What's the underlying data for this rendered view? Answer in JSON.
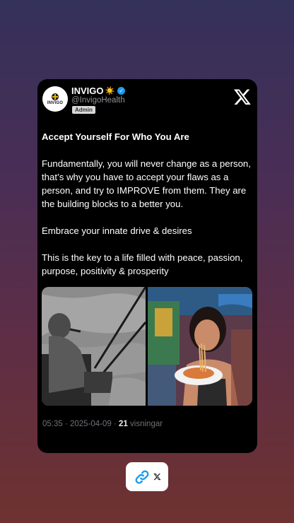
{
  "post": {
    "display_name": "INVIGO",
    "name_emoji": "☀️",
    "handle": "@InvigoHealth",
    "badge": "Admin",
    "avatar_text": "INVIGO",
    "title": "Accept Yourself For Who You Are",
    "paragraphs": [
      "Fundamentally, you will never change as a person, that’s why you have to accept your flaws as a person, and try to IMPROVE from them. They are the building blocks to a better you.",
      "Embrace your innate drive & desires",
      "This is the key to a life filled with peace, passion, purpose, positivity & prosperity"
    ],
    "meta": {
      "time_date": "05:35 · 2025-04-09 · ",
      "views_count": "21",
      "views_label": " visningar"
    },
    "media": [
      {
        "icon": "photo-man-fishing-bw"
      },
      {
        "icon": "photo-woman-eating-spaghetti"
      }
    ]
  },
  "share": {
    "link_icon": "link-icon",
    "platform_icon": "x-logo-icon"
  },
  "colors": {
    "link_blue": "#1d9bf0",
    "card_bg": "#000000",
    "muted_text": "#6d7176"
  }
}
